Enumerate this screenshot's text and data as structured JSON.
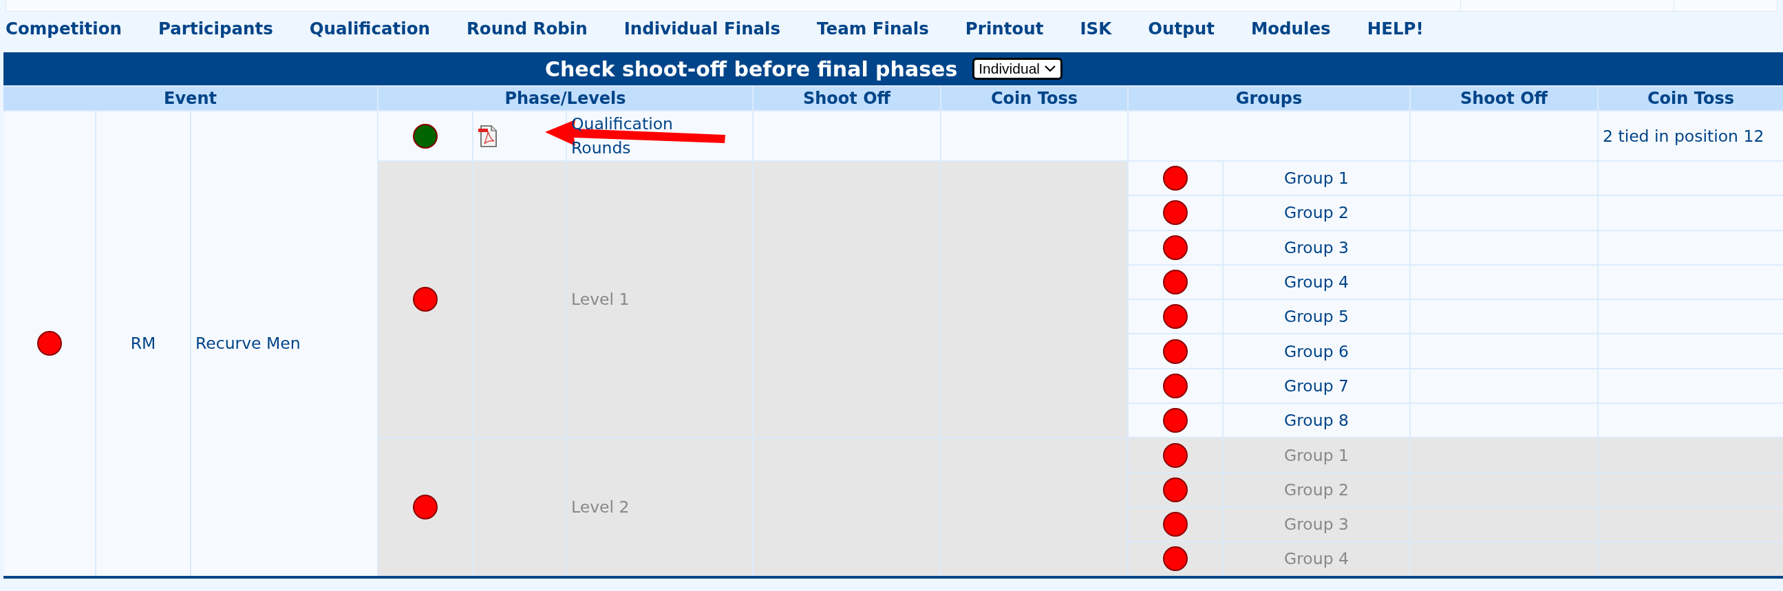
{
  "menu": [
    {
      "label": "Competition"
    },
    {
      "label": "Participants"
    },
    {
      "label": "Qualification"
    },
    {
      "label": "Round Robin"
    },
    {
      "label": "Individual Finals"
    },
    {
      "label": "Team Finals"
    },
    {
      "label": "Printout"
    },
    {
      "label": "ISK"
    },
    {
      "label": "Output"
    },
    {
      "label": "Modules"
    },
    {
      "label": "HELP!"
    }
  ],
  "title": "Check shoot-off before final phases",
  "phase_select": {
    "value": "Individual"
  },
  "columns": [
    "Event",
    "Phase/Levels",
    "Shoot Off",
    "Coin Toss",
    "Groups",
    "Shoot Off",
    "Coin Toss"
  ],
  "events": [
    {
      "color": "#ff0000",
      "code": "RM",
      "name": "Recurve Men",
      "qualification": {
        "color": "#006400",
        "label": "Qualification Rounds",
        "coin_toss": "2 tied in position 12"
      },
      "levels": [
        {
          "color": "#ff0000",
          "label": "Level 1",
          "disabled": true,
          "groups": [
            {
              "label": "Group 1",
              "color": "#ff0000",
              "disabled": false
            },
            {
              "label": "Group 2",
              "color": "#ff0000",
              "disabled": false
            },
            {
              "label": "Group 3",
              "color": "#ff0000",
              "disabled": false
            },
            {
              "label": "Group 4",
              "color": "#ff0000",
              "disabled": false
            },
            {
              "label": "Group 5",
              "color": "#ff0000",
              "disabled": false
            },
            {
              "label": "Group 6",
              "color": "#ff0000",
              "disabled": false
            },
            {
              "label": "Group 7",
              "color": "#ff0000",
              "disabled": false
            },
            {
              "label": "Group 8",
              "color": "#ff0000",
              "disabled": false
            }
          ]
        },
        {
          "color": "#ff0000",
          "label": "Level 2",
          "disabled": true,
          "groups": [
            {
              "label": "Group 1",
              "color": "#ff0000",
              "disabled": true
            },
            {
              "label": "Group 2",
              "color": "#ff0000",
              "disabled": true
            },
            {
              "label": "Group 3",
              "color": "#ff0000",
              "disabled": true
            },
            {
              "label": "Group 4",
              "color": "#ff0000",
              "disabled": true
            }
          ]
        }
      ]
    }
  ]
}
